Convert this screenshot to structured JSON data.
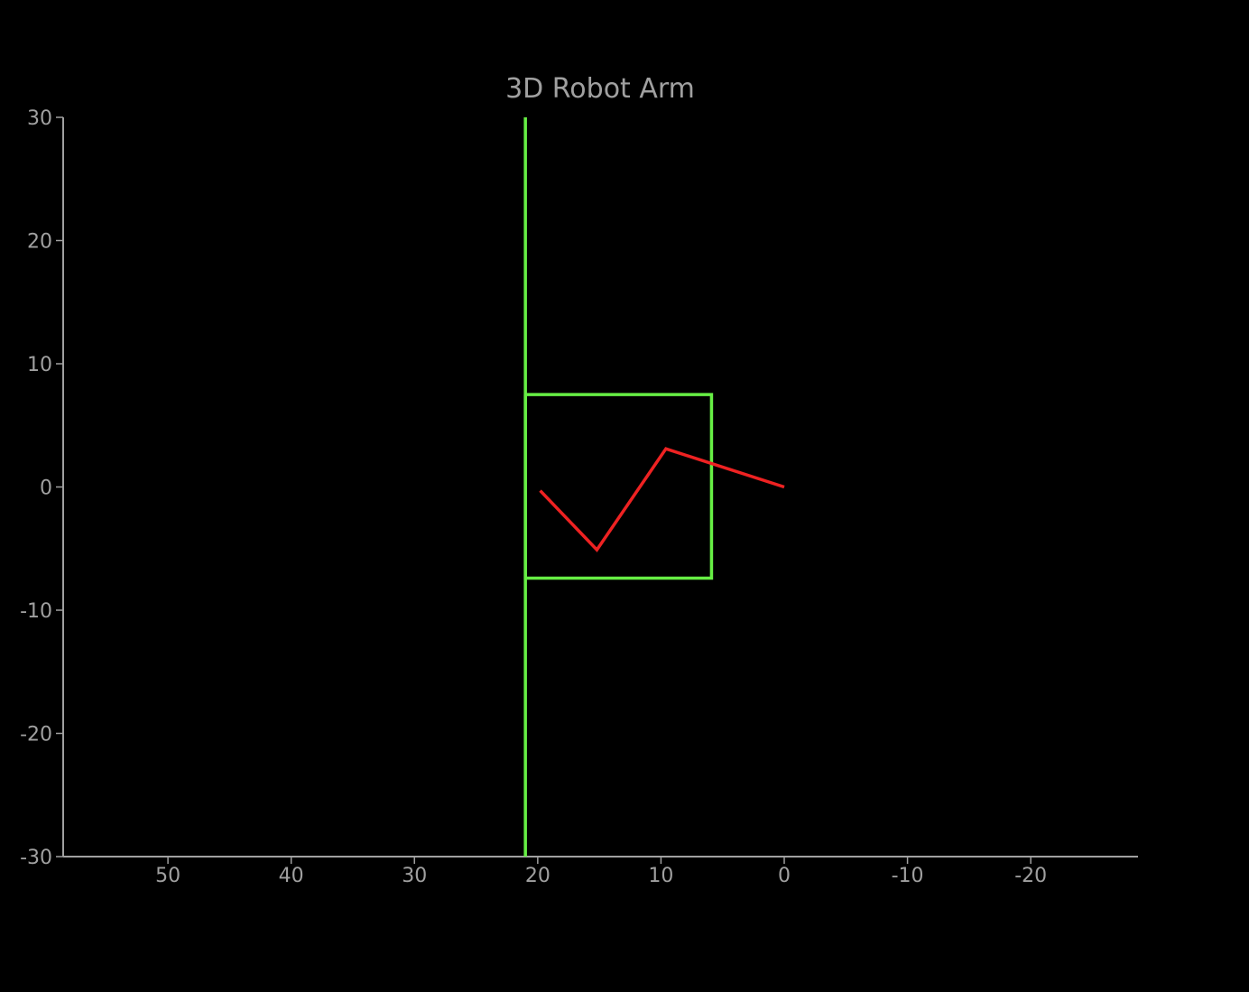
{
  "chart_data": {
    "type": "line",
    "title": "3D Robot Arm",
    "xlabel": "",
    "ylabel": "",
    "xlim": [
      58.5,
      -28.7
    ],
    "ylim": [
      -30,
      30
    ],
    "x_inverted": true,
    "x_ticks": [
      50,
      40,
      30,
      20,
      10,
      0,
      -10,
      -20
    ],
    "x_tick_labels": [
      "50",
      "40",
      "30",
      "20",
      "10",
      "0",
      "-10",
      "-20"
    ],
    "y_ticks": [
      30,
      20,
      10,
      0,
      -10,
      -20,
      -30
    ],
    "y_tick_labels": [
      "30",
      "20",
      "10",
      "0",
      "-10",
      "-20",
      "-30"
    ],
    "grid": false,
    "background": "#000000",
    "axis_color": "#a0a0a0",
    "text_color": "#a0a0a0",
    "series": [
      {
        "kind": "vertical-line",
        "color": "#66ee44",
        "x": [
          21,
          21
        ],
        "y": [
          30,
          -30
        ]
      },
      {
        "kind": "rectangle",
        "color": "#66ee44",
        "x": [
          21,
          5.9,
          5.9,
          21,
          21
        ],
        "y": [
          7.5,
          7.5,
          -7.4,
          -7.4,
          7.5
        ]
      },
      {
        "kind": "arm-links",
        "color": "#ee2222",
        "x": [
          19.8,
          15.2,
          9.6,
          0
        ],
        "y": [
          -0.3,
          -5.1,
          3.1,
          0
        ]
      }
    ]
  }
}
